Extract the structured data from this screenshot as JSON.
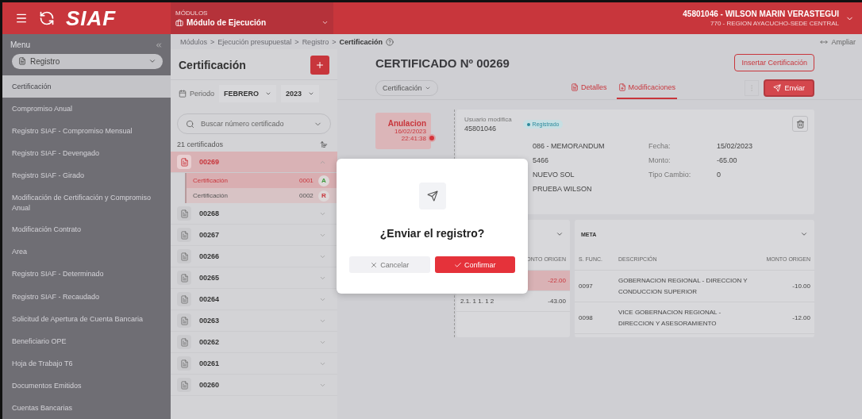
{
  "header": {
    "logo": "SIAF",
    "module_caption": "MÓDULOS",
    "module": "Módulo de Ejecución",
    "user": "45801046 - WILSON MARIN VERASTEGUI",
    "unit": "770 - REGION AYACUCHO-SEDE CENTRAL"
  },
  "sidebar": {
    "title": "Menu",
    "section": "Registro",
    "items": [
      {
        "label": "Certificación",
        "selected": true
      },
      {
        "label": "Compromiso Anual",
        "selected": false
      },
      {
        "label": "Registro SIAF - Compromiso Mensual",
        "selected": false
      },
      {
        "label": "Registro SIAF - Devengado",
        "selected": false
      },
      {
        "label": "Registro SIAF - Girado",
        "selected": false
      },
      {
        "label": "Modificación de Certificación y Compromiso Anual",
        "selected": false
      },
      {
        "label": "Modificación Contrato",
        "selected": false
      },
      {
        "label": "Area",
        "selected": false
      },
      {
        "label": "Registro SIAF - Determinado",
        "selected": false
      },
      {
        "label": "Registro SIAF - Recaudado",
        "selected": false
      },
      {
        "label": "Solicitud de Apertura de Cuenta Bancaria",
        "selected": false
      },
      {
        "label": "Beneficiario OPE",
        "selected": false
      },
      {
        "label": "Hoja de Trabajo T6",
        "selected": false
      },
      {
        "label": "Documentos Emitidos",
        "selected": false
      },
      {
        "label": "Cuentas Bancarias",
        "selected": false
      }
    ]
  },
  "breadcrumb": {
    "separator": ">",
    "items": [
      "Módulos",
      "Ejecución presupuestal",
      "Registro",
      "Certificación"
    ],
    "expand": "Ampliar"
  },
  "list": {
    "title": "Certificación",
    "period_label": "Periodo",
    "month": "FEBRERO",
    "year": "2023",
    "search_placeholder": "Buscar número certificado",
    "count": "21 certificados",
    "items": [
      {
        "number": "00269",
        "expanded": true,
        "children": [
          {
            "label": "Certificación",
            "code": "0001",
            "badge": "A",
            "color": "#3f9a3c",
            "selected": true
          },
          {
            "label": "Certificación",
            "code": "0002",
            "badge": "R",
            "color": "#c8363c",
            "selected": false
          }
        ]
      },
      {
        "number": "00268",
        "expanded": false
      },
      {
        "number": "00267",
        "expanded": false
      },
      {
        "number": "00266",
        "expanded": false
      },
      {
        "number": "00265",
        "expanded": false
      },
      {
        "number": "00264",
        "expanded": false
      },
      {
        "number": "00263",
        "expanded": false
      },
      {
        "number": "00262",
        "expanded": false
      },
      {
        "number": "00261",
        "expanded": false
      },
      {
        "number": "00260",
        "expanded": false
      }
    ]
  },
  "detail": {
    "title": "CERTIFICADO Nº 00269",
    "insert_button": "Insertar Certificación",
    "type_select": "Certificación",
    "tabs": [
      {
        "label": "Detalles",
        "selected": false
      },
      {
        "label": "Modificaciones",
        "selected": true
      }
    ],
    "send_button": "Enviar",
    "timeline": {
      "label": "Anulacion",
      "date": "16/02/2023",
      "time": "22:41:38"
    },
    "record": {
      "user_label": "Usuario modifica",
      "user": "45801046",
      "status": "Registrado",
      "rows": [
        {
          "value": "086 - MEMORANDUM",
          "label": "Fecha:",
          "value2": "15/02/2023"
        },
        {
          "value": "5466",
          "label": "Monto:",
          "value2": "-65.00"
        },
        {
          "value": "NUEVO SOL",
          "label": "Tipo Cambio:",
          "value2": "0"
        },
        {
          "value": "PRUEBA WILSON"
        }
      ]
    },
    "classifier": {
      "column": "ONTO ORIGEN",
      "rows": [
        {
          "code": "",
          "amount": "-22.00",
          "selected": true
        },
        {
          "code": "2.1. 1 1. 1 2",
          "amount": "-43.00",
          "selected": false
        }
      ]
    },
    "meta": {
      "title": "META",
      "columns": [
        "S. FUNC.",
        "DESCRIPCIÓN",
        "MONTO ORIGEN"
      ],
      "rows": [
        {
          "code": "0097",
          "description": "GOBERNACION REGIONAL - DIRECCION Y CONDUCCION SUPERIOR",
          "amount": "-10.00"
        },
        {
          "code": "0098",
          "description": "VICE GOBERNACION REGIONAL - DIRECCION Y ASESORAMIENTO",
          "amount": "-12.00"
        }
      ]
    }
  },
  "dialog": {
    "title": "¿Enviar el registro?",
    "cancel": "Cancelar",
    "confirm": "Confirmar"
  }
}
